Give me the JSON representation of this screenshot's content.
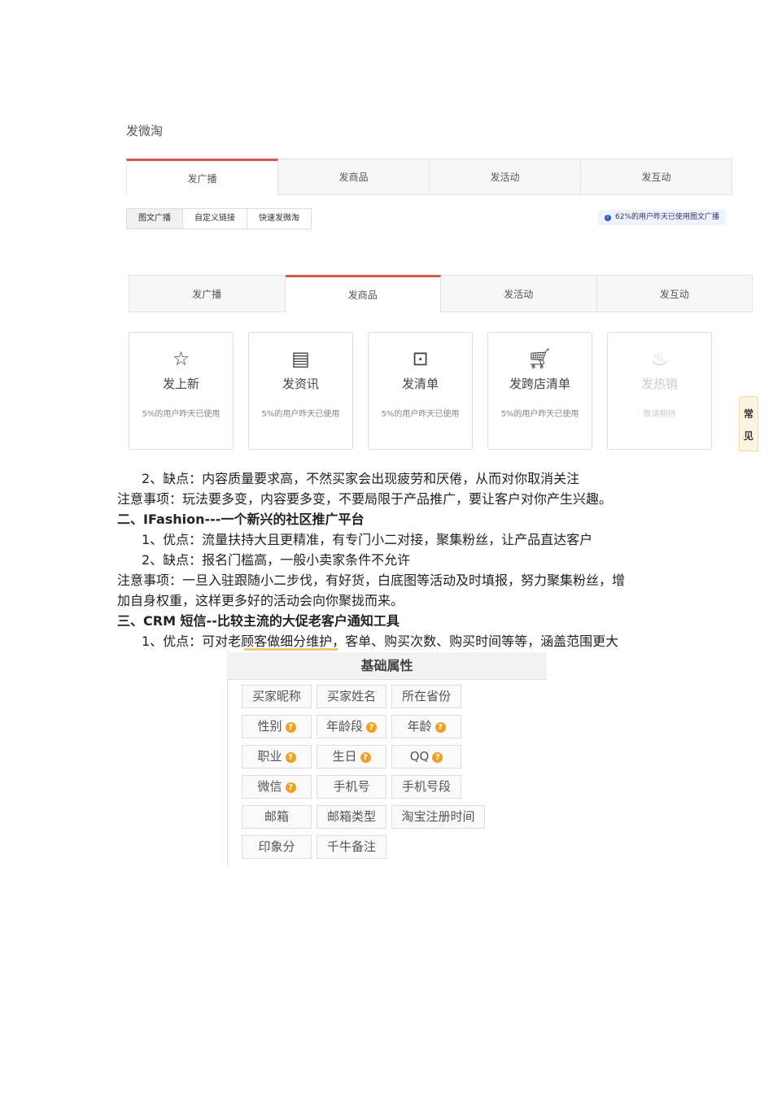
{
  "screenshot1": {
    "title": "发微淘",
    "tabs": [
      "发广播",
      "发商品",
      "发活动",
      "发互动"
    ],
    "segments": [
      "图文广播",
      "自定义链接",
      "快速发微淘"
    ],
    "tip": "62%的用户昨天已使用图文广播"
  },
  "screenshot2": {
    "tabs": [
      "发广播",
      "发商品",
      "发活动",
      "发互动"
    ],
    "cards": [
      {
        "name": "发上新",
        "stat": "5%的用户昨天已使用",
        "icon": "star-icon"
      },
      {
        "name": "发资讯",
        "stat": "5%的用户昨天已使用",
        "icon": "news-icon"
      },
      {
        "name": "发清单",
        "stat": "5%的用户昨天已使用",
        "icon": "bag-icon"
      },
      {
        "name": "发跨店清单",
        "stat": "5%的用户昨天已使用",
        "icon": "cart-icon"
      },
      {
        "name": "发热销",
        "stat": "敬请期待",
        "icon": "fire-icon"
      }
    ],
    "side_tab": [
      "常",
      "见"
    ]
  },
  "text": [
    "2、缺点：内容质量要求高，不然买家会出现疲劳和厌倦，从而对你取消关注",
    "注意事项：玩法要多变，内容要多变，不要局限于产品推广，要让客户对你产生兴趣。",
    "二、IFashion---一个新兴的社区推广平台",
    "1、优点：流量扶持大且更精准，有专门小二对接，聚集粉丝，让产品直达客户",
    "2、缺点：报名门槛高，一般小卖家条件不允许",
    "注意事项：一旦入驻跟随小二步伐，有好货，白底图等活动及时填报，努力聚集粉丝，增",
    "加自身权重，这样更多好的活动会向你聚拢而来。",
    "三、CRM 短信--比较主流的大促老客户通知工具",
    "1、优点：可对老顾客做细分维护，客单、购买次数、购买时间等等，涵盖范围更大"
  ],
  "screenshot3": {
    "header": "基础属性",
    "tags": [
      [
        "买家昵称",
        "买家姓名",
        "所在省份"
      ],
      [
        "性别",
        "年龄段",
        "年龄"
      ],
      [
        "职业",
        "生日",
        "QQ"
      ],
      [
        "微信",
        "手机号",
        "手机号段"
      ],
      [
        "邮箱",
        "邮箱类型",
        "淘宝注册时间"
      ],
      [
        "印象分",
        "千牛备注"
      ]
    ],
    "help_mark": "?"
  }
}
